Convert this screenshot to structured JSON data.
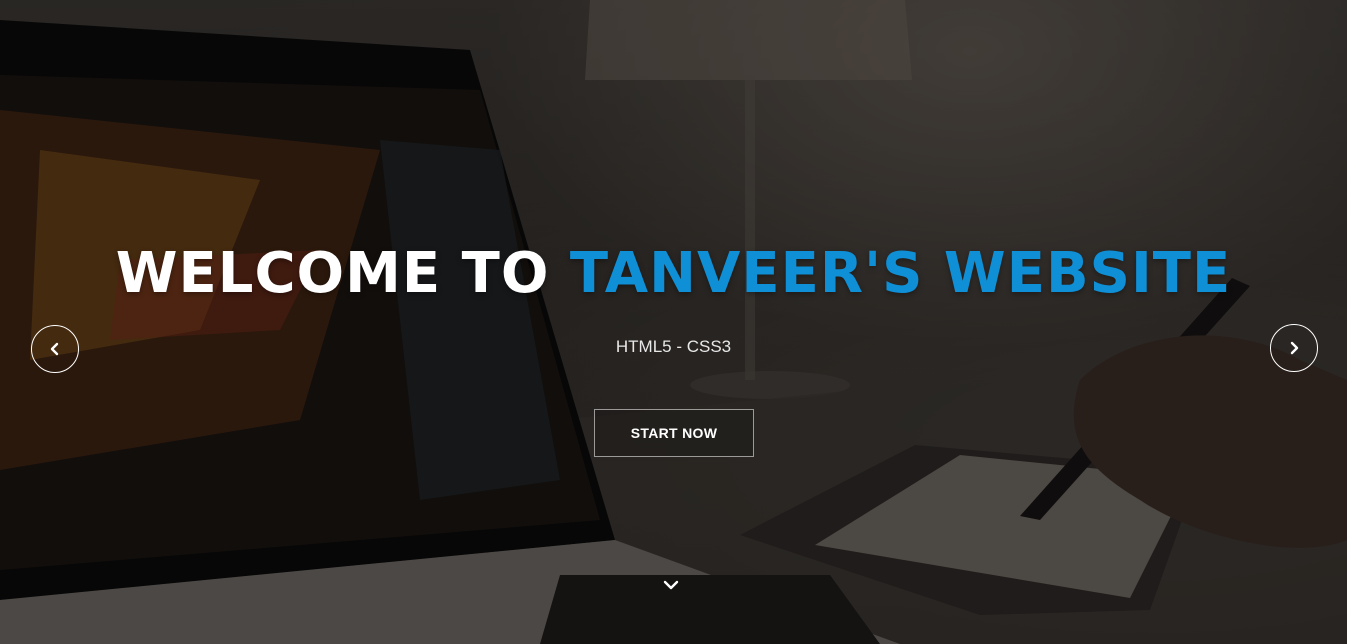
{
  "hero": {
    "headline_prefix": "WELCOME TO ",
    "headline_highlight": "TANVEER'S WEBSITE",
    "subtitle": "HTML5 - CSS3",
    "cta_label": "START NOW"
  },
  "carousel": {
    "prev_icon": "chevron-left-icon",
    "next_icon": "chevron-right-icon"
  },
  "scroll": {
    "icon": "chevron-down-icon"
  },
  "colors": {
    "accent": "#0f8fd6",
    "text": "#ffffff"
  }
}
